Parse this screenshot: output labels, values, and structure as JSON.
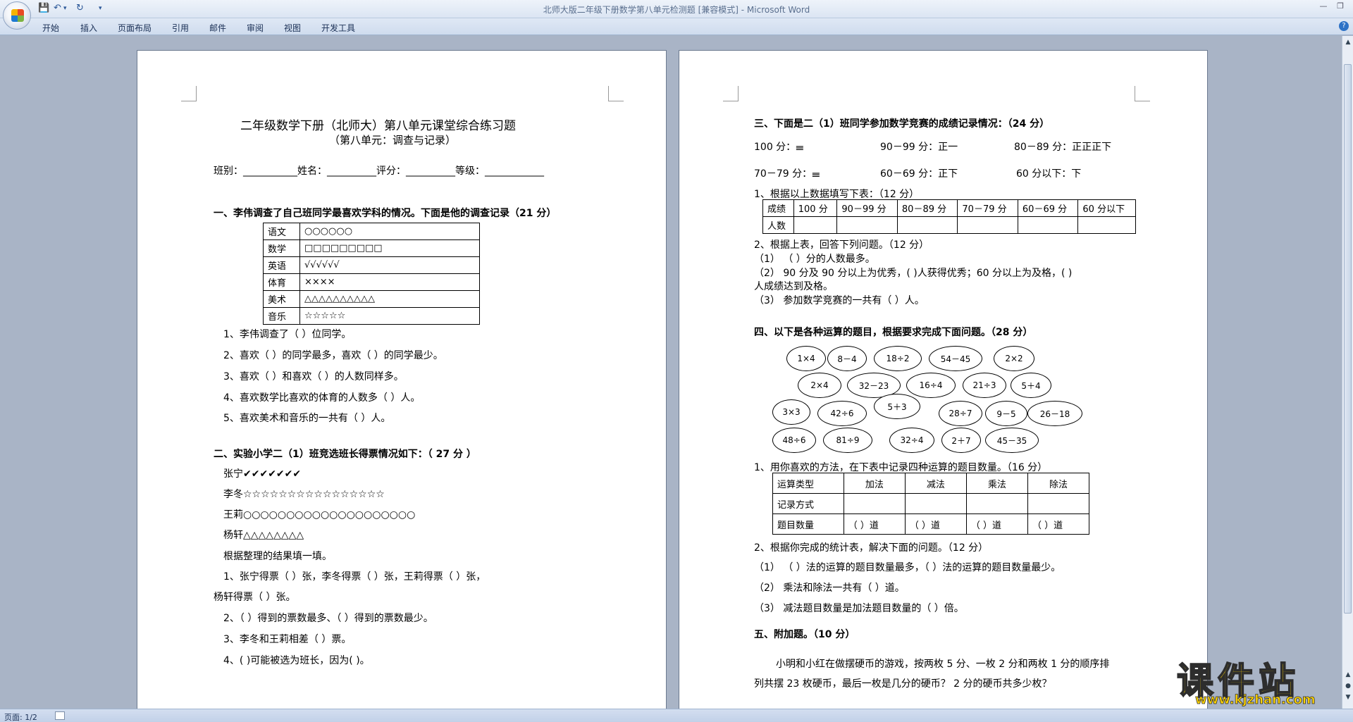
{
  "window": {
    "title": "北师大版二年级下册数学第八单元检测题 [兼容模式] - Microsoft Word",
    "qat": [
      "save-icon",
      "undo-icon",
      "redo-icon",
      "customize-icon"
    ]
  },
  "menu": [
    "开始",
    "插入",
    "页面布局",
    "引用",
    "邮件",
    "审阅",
    "视图",
    "开发工具"
  ],
  "status": {
    "page": "页面: 1/2"
  },
  "watermark": {
    "title": "课件站",
    "url": "www.kjzhan.com"
  },
  "page1": {
    "title": "二年级数学下册（北师大）第八单元课堂综合练习题",
    "subtitle": "（第八单元：调查与记录）",
    "info": "班别：___________姓名：__________评分：__________等级：____________",
    "s1_heading": "一、李伟调查了自己班同学最喜欢学科的情况。下面是他的调查记录（21 分）",
    "s1_table": [
      [
        "语文",
        "○○○○○○"
      ],
      [
        "数学",
        "□□□□□□□□□"
      ],
      [
        "英语",
        "√√√√√√"
      ],
      [
        "体育",
        "××××"
      ],
      [
        "美术",
        "△△△△△△△△△△"
      ],
      [
        "音乐",
        "☆☆☆☆☆"
      ]
    ],
    "s1_q": [
      "1、李伟调查了（          ）位同学。",
      "2、喜欢（          ）的同学最多，喜欢（          ）的同学最少。",
      "3、喜欢（          ）和喜欢（          ）的人数同样多。",
      "4、喜欢数学比喜欢的体育的人数多（          ）人。",
      "5、喜欢美术和音乐的一共有（          ）人。"
    ],
    "s2_heading": "二、实验小学二（1）班竞选班长得票情况如下：（ 27 分 ）",
    "s2_votes": [
      "张宁✔✔✔✔✔✔✔",
      "李冬☆☆☆☆☆☆☆☆☆☆☆☆☆☆☆☆",
      "王莉○○○○○○○○○○○○○○○○○○○○",
      "杨轩△△△△△△△△"
    ],
    "s2_instr": "根据整理的结果填一填。",
    "s2_q1a": "1、张宁得票（          ）张，李冬得票（          ）张，王莉得票（          ）张，",
    "s2_q1b": "杨轩得票（          ）张。",
    "s2_q2": "2、（          ）得到的票数最多、（          ）得到的票数最少。",
    "s2_q3": "3、李冬和王莉相差（          ）票。",
    "s2_q4": "4、(          )可能被选为班长，因为(                                                              )。"
  },
  "page2": {
    "s3_heading": "三、下面是二（1）班同学参加数学竞赛的成绩记录情况：（24 分）",
    "s3_row1": [
      "100 分：𝍢",
      "90－99 分：正⼀",
      "80－89 分：正正正下"
    ],
    "s3_row2": [
      "70－79 分：𝍢",
      "60－69 分：正下",
      "60 分以下：下"
    ],
    "s3_q1": "1、根据以上数据填写下表：（12 分）",
    "s3_table_head": [
      "成绩",
      "100 分",
      "90－99 分",
      "80－89 分",
      "70－79 分",
      "60－69 分",
      "60 分以下"
    ],
    "s3_table_row": [
      "人数",
      "",
      "",
      "",
      "",
      "",
      ""
    ],
    "s3_q2": "2、根据上表，回答下列问题。（12 分）",
    "s3_q2_1": "（1）  （          ）分的人数最多。",
    "s3_q2_2a": "（2）  90 分及 90 分以上为优秀，(          )人获得优秀；60 分以上为及格，(          )",
    "s3_q2_2b": "人成绩达到及格。",
    "s3_q2_3": "（3）  参加数学竞赛的一共有（          ）人。",
    "s4_heading": "四、以下是各种运算的题目，根据要求完成下面问题。（28 分）",
    "ovals": [
      "1×4",
      "8－4",
      "18÷2",
      "54－45",
      "2×2",
      "2×4",
      "32－23",
      "16÷4",
      "21÷3",
      "5＋4",
      "3×3",
      "42÷6",
      "5＋3",
      "28÷7",
      "9－5",
      "26－18",
      "48÷6",
      "81÷9",
      "32÷4",
      "2＋7",
      "45－35"
    ],
    "s4_q1": "1、用你喜欢的方法，在下表中记录四种运算的题目数量。（16 分）",
    "s4_table": [
      [
        "运算类型",
        "加法",
        "减法",
        "乘法",
        "除法"
      ],
      [
        "记录方式",
        "",
        "",
        "",
        ""
      ],
      [
        "题目数量",
        "（   ）道",
        "（   ）道",
        "（   ）道",
        "（   ）道"
      ]
    ],
    "s4_q2": "2、根据你完成的统计表，解决下面的问题。（12 分）",
    "s4_q2_1": "（1）  （     ）法的运算的题目数量最多，（     ）法的运算的题目数量最少。",
    "s4_q2_2": "（2）  乘法和除法一共有（          ）道。",
    "s4_q2_3": "（3）  减法题目数量是加法题目数量的（          ）倍。",
    "s5_heading": "五、附加题。（10 分）",
    "s5_text1": "小明和小红在做摆硬币的游戏，按两枚 5 分、一枚 2 分和两枚 1 分的顺序排",
    "s5_text2": "列共摆 23 枚硬币，最后一枚是几分的硬币？  2 分的硬币共多少枚？"
  }
}
